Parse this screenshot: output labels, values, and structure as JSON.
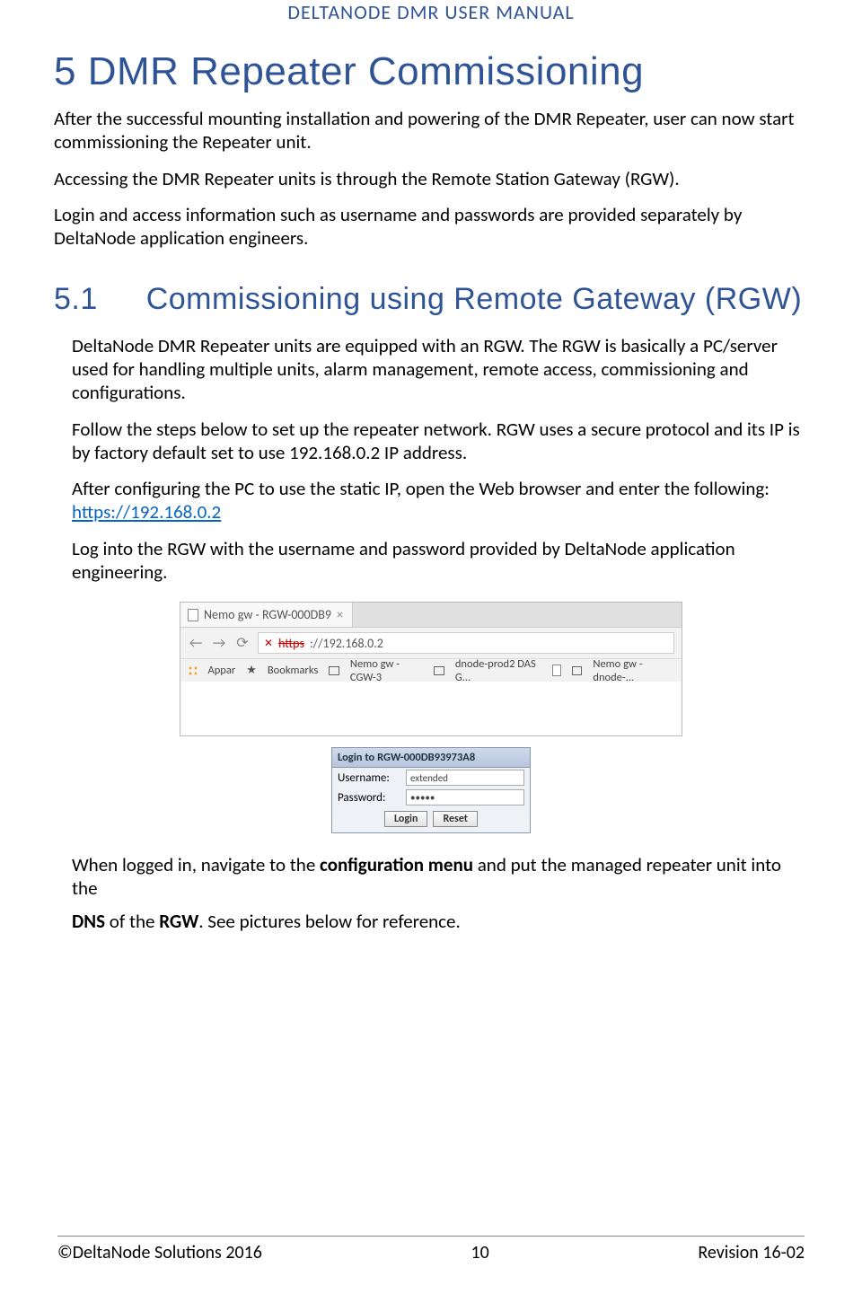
{
  "header": {
    "manual_title": "DELTANODE DMR USER MANUAL"
  },
  "h1": "5 DMR Repeater Commissioning",
  "p1": "After the successful mounting installation and powering of the DMR Repeater, user can now start commissioning the Repeater unit.",
  "p2": "Accessing the DMR Repeater units is  through the Remote Station Gateway (RGW).",
  "p3": "Login and access information such as username and passwords are provided separately by DeltaNode application engineers.",
  "h2_prefix": "5.1",
  "h2_rest": "Commissioning using Remote Gateway (RGW)",
  "sp1": "DeltaNode DMR Repeater units are equipped with an RGW. The RGW is basically a PC/server used for handling multiple units, alarm  management, remote access, commissioning and configurations.",
  "sp2": "Follow the steps below to set up the  repeater network. RGW uses a secure protocol and its IP is by factory default set to use 192.168.0.2  IP address.",
  "sp3_pre": "After configuring the PC to use the static IP, open the Web browser and enter the   following: ",
  "sp3_link": "https://192.168.0.2",
  "sp4": "Log into the RGW with the username and password provided by DeltaNode application engineering.",
  "browser": {
    "tab_title": "Nemo gw - RGW-000DB9",
    "url_scheme": "https",
    "url_rest": "://192.168.0.2",
    "bookmarks": {
      "apps": "Appar",
      "bm1": "Bookmarks",
      "bm2": "Nemo gw - CGW-3",
      "bm3": "dnode-prod2 DAS G...",
      "bm4": "Nemo gw - dnode-..."
    }
  },
  "login": {
    "title": "Login to RGW-000DB93973A8",
    "username_label": "Username:",
    "username_value": "extended",
    "password_label": "Password:",
    "password_value": "•••••",
    "login_btn": "Login",
    "reset_btn": "Reset"
  },
  "after1_a": "When logged in, navigate to the ",
  "after1_b": "configuration menu",
  "after1_c": " and put the managed repeater unit into the",
  "after2_a": "DNS",
  "after2_b": " of the ",
  "after2_c": "RGW",
  "after2_d": ". See pictures below for reference.",
  "footer": {
    "left": "©DeltaNode Solutions 2016",
    "center": "10",
    "right": "Revision 16-02"
  }
}
